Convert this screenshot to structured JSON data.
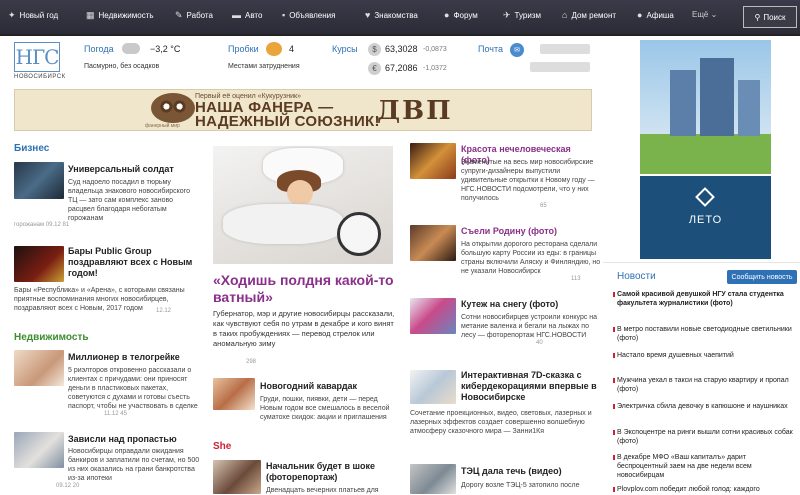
{
  "nav": {
    "items": [
      {
        "label": "Новый год",
        "icon": "christmas-ornament-icon"
      },
      {
        "label": "Недвижимость",
        "icon": "building-icon"
      },
      {
        "label": "Работа",
        "icon": "wrench-icon"
      },
      {
        "label": "Авто",
        "icon": "car-icon"
      },
      {
        "label": "Объявления",
        "icon": "chat-icon"
      },
      {
        "label": "Знакомства",
        "icon": "heart-icon"
      },
      {
        "label": "Форум",
        "icon": "speech-bubble-icon"
      },
      {
        "label": "Туризм",
        "icon": "plane-icon"
      },
      {
        "label": "Дом ремонт",
        "icon": "house-icon"
      },
      {
        "label": "Афиша",
        "icon": "ticket-icon"
      }
    ],
    "more_label": "Ещё",
    "search_label": "Поиск"
  },
  "logo": {
    "mark": "НГС",
    "sub": "НОВОСИБИРСК"
  },
  "weather": {
    "label": "Погода",
    "temp": "−3,2 °С",
    "desc": "Пасмурно, без осадков"
  },
  "traffic": {
    "label": "Пробки",
    "score": "4",
    "desc": "Местами затруднения"
  },
  "rates": {
    "label": "Курсы",
    "usd": {
      "symbol": "$",
      "value": "63,3028",
      "change": "-0,0873"
    },
    "eur": {
      "symbol": "€",
      "value": "67,2086",
      "change": "-1,0372"
    }
  },
  "mail": {
    "label": "Почта"
  },
  "banner": {
    "small": "Первый её оценил «Кукурузник»",
    "line1": "НАША ФАНЕРА —",
    "line2": "НАДЕЖНЫЙ СОЮЗНИК!",
    "brand": "ДВП",
    "tag": "фанерный мир"
  },
  "sections": {
    "business": "Бизнес",
    "realty": "Недвижимость",
    "she": "She"
  },
  "business_news": [
    {
      "title": "Универсальный солдат",
      "text": "Суд надоело посадил в тюрьму владельца знакового новосибирского ТЦ — зато сам комплекс заново расцвел благодаря небогатым горожанам",
      "meta": "горожанам  09.12  81"
    },
    {
      "title": "Бары Public Group поздравляют всех с Новым годом!",
      "text": "Бары «Республика» и «Арена», с которыми связаны приятные воспоминания многих новосибирцев, поздравляют всех с Новым, 2017 годом",
      "meta": "12.12"
    }
  ],
  "realty_news": [
    {
      "title": "Миллионер в телогрейке",
      "text": "5 риэлторов откровенно рассказали о клиентах с причудами: они приносят деньги в пластиковых пакетах, советуются с духами и готовы съесть паспорт, чтобы не участвовать в сделке",
      "meta": "11.12  45"
    },
    {
      "title": "Зависли над пропастью",
      "text": "Новосибирцы оправдали ожидания банкиров и заплатили по счетам, но 500 из них оказались на грани банкротства из-за ипотеки",
      "meta": "09.12  20"
    }
  ],
  "feature": {
    "title": "«Ходишь полдня какой-то ватный»",
    "text": "Губернатор, мэр и другие новосибирцы рассказали, как чувствуют себя по утрам в декабре и кого винят в таких пробуждениях — перевод стрелок или аномальную зиму",
    "meta": "298"
  },
  "middle_news": [
    {
      "title": "Новогодний кавардак",
      "text": "Груди, пошки, пиявки, дети — перед Новым годом все смешалось в веселой суматохе скидок: акции и приглашения"
    }
  ],
  "she_news": [
    {
      "title": "Начальник будет в шоке (фоторепортаж)",
      "text": "Двенадцать вечерних платьев для"
    }
  ],
  "right_news": [
    {
      "title": "Красота нечеловеческая (фото)",
      "text": "Знаменитые на весь мир новосибирские супруги-дизайнеры выпустили удивительные открытки к Новому году — НГС.НОВОСТИ подсмотрели, что у них получилось",
      "meta": "65"
    },
    {
      "title": "Съели Родину (фото)",
      "text": "На открытии дорогого ресторана сделали большую карту России из еды: в границы страны включили Аляску и Финляндию, но не указали Новосибирск",
      "meta": "113"
    },
    {
      "title": "Кутеж на снегу (фото)",
      "text": "Сотни новосибирцев устроили конкурс на метание валенка и бегали на лыжах по лесу — фоторепортаж НГС.НОВОСТИ",
      "meta": "40"
    },
    {
      "title": "Интерактивная 7D-сказка с кибердекорациями впервые в Новосибирске",
      "text": "Сочетание проекционных, видео, световых, лазерных и лазерных эффектов создает совершенно волшебную атмосферу сказочного мира — Занни1Кя",
      "meta": ""
    },
    {
      "title": "ТЭЦ дала течь (видео)",
      "text": "Дорогу возле ТЭЦ-5 затопило после",
      "meta": ""
    }
  ],
  "ads": {
    "leto": "ЛЕТО"
  },
  "news_panel": {
    "title": "Новости",
    "button": "Сообщить новость",
    "items": [
      {
        "text": "Самой красивой девушкой НГУ стала студентка факультета журналистики (фото)",
        "bold": true
      },
      {
        "text": "В метро поставили новые светодиодные светильники (фото)",
        "bold": false
      },
      {
        "text": "Настало время душевных чаепитий",
        "bold": false
      },
      {
        "text": "Мужчина уехал в такси на старую квартиру и пропал (фото)",
        "bold": false
      },
      {
        "text": "Электричка сбила девочку в капюшоне и наушниках",
        "bold": false
      },
      {
        "text": "В Экспоцентре на ринги вышли сотни красивых собак (фото)",
        "bold": false
      },
      {
        "text": "В декабре МФО «Ваш капиталъ» дарит беспроцентный заем на две недели всем новосибирцам",
        "bold": false
      },
      {
        "text": "Plovplov.com победит любой голод: каждого",
        "bold": false
      }
    ]
  },
  "colors": {
    "accent": "#2e71b5",
    "purple": "#8a2f8a",
    "green": "#3d8e2f",
    "red": "#cc2233"
  }
}
